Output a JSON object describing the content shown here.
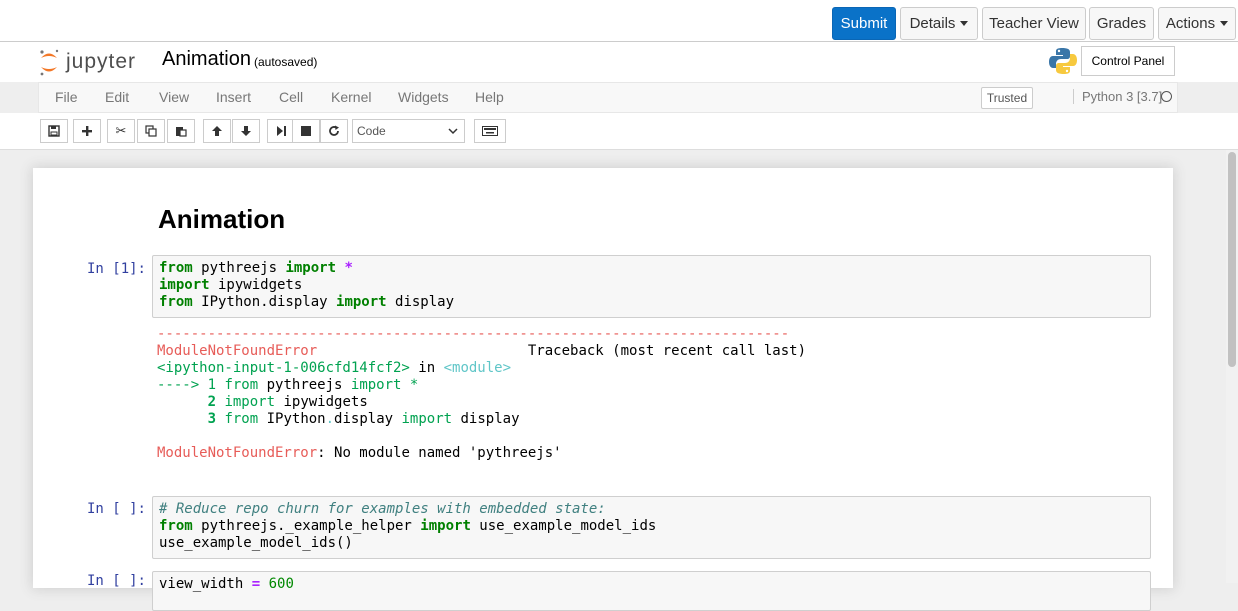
{
  "topbar": {
    "submit": "Submit",
    "details": "Details",
    "teacher_view": "Teacher View",
    "grades": "Grades",
    "actions": "Actions"
  },
  "header": {
    "logo_text": "jupyter",
    "notebook_title": "Animation",
    "autosave": "(autosaved)",
    "control_panel": "Control Panel"
  },
  "menubar": {
    "items": [
      "File",
      "Edit",
      "View",
      "Insert",
      "Cell",
      "Kernel",
      "Widgets",
      "Help"
    ],
    "trusted": "Trusted",
    "kernel": "Python 3 [3.7]"
  },
  "toolbar": {
    "cell_type": "Code",
    "icons": [
      "save-icon",
      "plus-icon",
      "cut-icon",
      "copy-icon",
      "paste-icon",
      "arrow-up-icon",
      "arrow-down-icon",
      "run-icon",
      "stop-icon",
      "restart-icon",
      "keyboard-icon"
    ]
  },
  "notebook": {
    "heading": "Animation",
    "cell1": {
      "prompt": "In [1]:",
      "line1_kw1": "from",
      "line1_mod": " pythreejs ",
      "line1_kw2": "import",
      "line1_star": " *",
      "line2_kw": "import",
      "line2_mod": " ipywidgets",
      "line3_kw1": "from",
      "line3_mod": " IPython.display ",
      "line3_kw2": "import",
      "line3_name": " display"
    },
    "error": {
      "dashes": "---------------------------------------------------------------------------",
      "error_name": "ModuleNotFoundError",
      "traceback_header": "                         Traceback (most recent call last)",
      "input_ref": "<ipython-input-1-006cfd14fcf2>",
      "in_text": " in ",
      "module_ref": "<module>",
      "arrow": "----> 1",
      "tb1_kw1": " from",
      "tb1_mod": " pythreejs ",
      "tb1_kw2": "import",
      "tb1_star": " *",
      "tb2_num": "      2",
      "tb2_kw": " import",
      "tb2_mod": " ipywidgets",
      "tb3_num": "      3",
      "tb3_kw1": " from",
      "tb3_mod": " IPython",
      "tb3_dot": ".",
      "tb3_attr": "display ",
      "tb3_kw2": "import",
      "tb3_name": " display",
      "final_name": "ModuleNotFoundError",
      "final_msg": ": No module named 'pythreejs'"
    },
    "cell2": {
      "prompt": "In [ ]:",
      "comment": "# Reduce repo churn for examples with embedded state:",
      "line2_kw1": "from",
      "line2_mod": " pythreejs._example_helper ",
      "line2_kw2": "import",
      "line2_name": " use_example_model_ids",
      "line3": "use_example_model_ids()"
    },
    "cell3": {
      "prompt": "In [ ]:",
      "line1_var": "view_width ",
      "line1_op": "=",
      "line1_num": " 600"
    }
  }
}
